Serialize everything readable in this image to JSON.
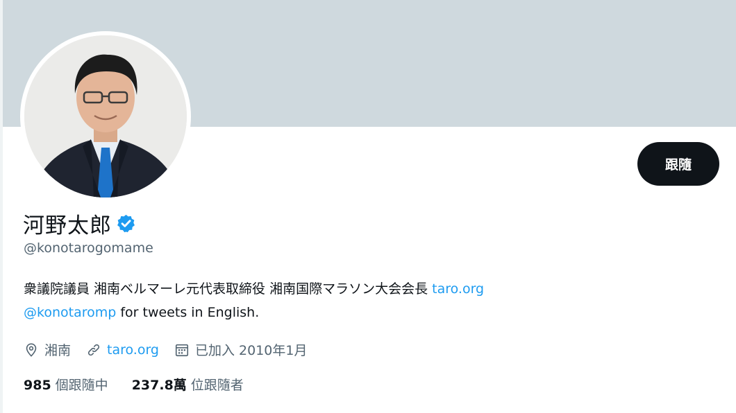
{
  "profile": {
    "display_name": "河野太郎",
    "handle": "@konotarogomame",
    "follow_button": "跟隨",
    "bio": {
      "text_1": "衆議院議員 湘南ベルマーレ元代表取締役 湘南国際マラソン大会会長 ",
      "link_1": "taro.org",
      "mention": "@konotaromp",
      "text_2": " for tweets in English."
    },
    "meta": {
      "location": "湘南",
      "website": "taro.org",
      "joined": "已加入 2010年1月"
    },
    "stats": {
      "following_count": "985",
      "following_label": "個跟隨中",
      "followers_count": "237.8萬",
      "followers_label": "位跟隨者"
    }
  },
  "icons": {
    "verified": "verified-badge-icon",
    "location": "location-pin-icon",
    "website": "link-icon",
    "joined": "calendar-icon"
  },
  "colors": {
    "banner": "#cfd9de",
    "link": "#1d9bf0",
    "verified": "#1d9bf0",
    "button_bg": "#0f1419",
    "muted_text": "#536471"
  }
}
